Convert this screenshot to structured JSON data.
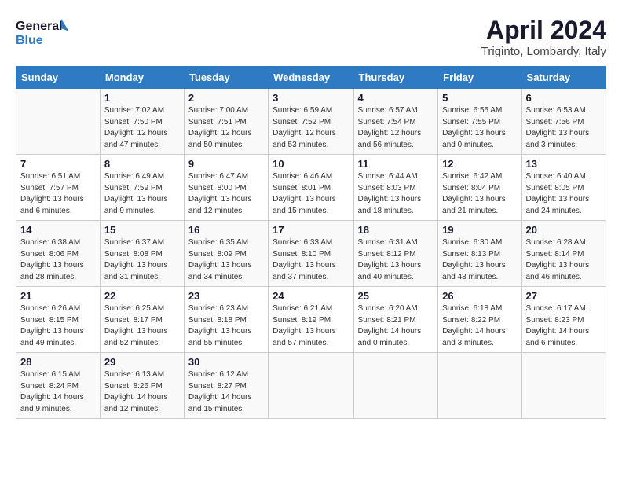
{
  "header": {
    "logo_line1": "General",
    "logo_line2": "Blue",
    "month_year": "April 2024",
    "location": "Triginto, Lombardy, Italy"
  },
  "days_of_week": [
    "Sunday",
    "Monday",
    "Tuesday",
    "Wednesday",
    "Thursday",
    "Friday",
    "Saturday"
  ],
  "weeks": [
    [
      {
        "day": "",
        "sunrise": "",
        "sunset": "",
        "daylight": ""
      },
      {
        "day": "1",
        "sunrise": "Sunrise: 7:02 AM",
        "sunset": "Sunset: 7:50 PM",
        "daylight": "Daylight: 12 hours and 47 minutes."
      },
      {
        "day": "2",
        "sunrise": "Sunrise: 7:00 AM",
        "sunset": "Sunset: 7:51 PM",
        "daylight": "Daylight: 12 hours and 50 minutes."
      },
      {
        "day": "3",
        "sunrise": "Sunrise: 6:59 AM",
        "sunset": "Sunset: 7:52 PM",
        "daylight": "Daylight: 12 hours and 53 minutes."
      },
      {
        "day": "4",
        "sunrise": "Sunrise: 6:57 AM",
        "sunset": "Sunset: 7:54 PM",
        "daylight": "Daylight: 12 hours and 56 minutes."
      },
      {
        "day": "5",
        "sunrise": "Sunrise: 6:55 AM",
        "sunset": "Sunset: 7:55 PM",
        "daylight": "Daylight: 13 hours and 0 minutes."
      },
      {
        "day": "6",
        "sunrise": "Sunrise: 6:53 AM",
        "sunset": "Sunset: 7:56 PM",
        "daylight": "Daylight: 13 hours and 3 minutes."
      }
    ],
    [
      {
        "day": "7",
        "sunrise": "Sunrise: 6:51 AM",
        "sunset": "Sunset: 7:57 PM",
        "daylight": "Daylight: 13 hours and 6 minutes."
      },
      {
        "day": "8",
        "sunrise": "Sunrise: 6:49 AM",
        "sunset": "Sunset: 7:59 PM",
        "daylight": "Daylight: 13 hours and 9 minutes."
      },
      {
        "day": "9",
        "sunrise": "Sunrise: 6:47 AM",
        "sunset": "Sunset: 8:00 PM",
        "daylight": "Daylight: 13 hours and 12 minutes."
      },
      {
        "day": "10",
        "sunrise": "Sunrise: 6:46 AM",
        "sunset": "Sunset: 8:01 PM",
        "daylight": "Daylight: 13 hours and 15 minutes."
      },
      {
        "day": "11",
        "sunrise": "Sunrise: 6:44 AM",
        "sunset": "Sunset: 8:03 PM",
        "daylight": "Daylight: 13 hours and 18 minutes."
      },
      {
        "day": "12",
        "sunrise": "Sunrise: 6:42 AM",
        "sunset": "Sunset: 8:04 PM",
        "daylight": "Daylight: 13 hours and 21 minutes."
      },
      {
        "day": "13",
        "sunrise": "Sunrise: 6:40 AM",
        "sunset": "Sunset: 8:05 PM",
        "daylight": "Daylight: 13 hours and 24 minutes."
      }
    ],
    [
      {
        "day": "14",
        "sunrise": "Sunrise: 6:38 AM",
        "sunset": "Sunset: 8:06 PM",
        "daylight": "Daylight: 13 hours and 28 minutes."
      },
      {
        "day": "15",
        "sunrise": "Sunrise: 6:37 AM",
        "sunset": "Sunset: 8:08 PM",
        "daylight": "Daylight: 13 hours and 31 minutes."
      },
      {
        "day": "16",
        "sunrise": "Sunrise: 6:35 AM",
        "sunset": "Sunset: 8:09 PM",
        "daylight": "Daylight: 13 hours and 34 minutes."
      },
      {
        "day": "17",
        "sunrise": "Sunrise: 6:33 AM",
        "sunset": "Sunset: 8:10 PM",
        "daylight": "Daylight: 13 hours and 37 minutes."
      },
      {
        "day": "18",
        "sunrise": "Sunrise: 6:31 AM",
        "sunset": "Sunset: 8:12 PM",
        "daylight": "Daylight: 13 hours and 40 minutes."
      },
      {
        "day": "19",
        "sunrise": "Sunrise: 6:30 AM",
        "sunset": "Sunset: 8:13 PM",
        "daylight": "Daylight: 13 hours and 43 minutes."
      },
      {
        "day": "20",
        "sunrise": "Sunrise: 6:28 AM",
        "sunset": "Sunset: 8:14 PM",
        "daylight": "Daylight: 13 hours and 46 minutes."
      }
    ],
    [
      {
        "day": "21",
        "sunrise": "Sunrise: 6:26 AM",
        "sunset": "Sunset: 8:15 PM",
        "daylight": "Daylight: 13 hours and 49 minutes."
      },
      {
        "day": "22",
        "sunrise": "Sunrise: 6:25 AM",
        "sunset": "Sunset: 8:17 PM",
        "daylight": "Daylight: 13 hours and 52 minutes."
      },
      {
        "day": "23",
        "sunrise": "Sunrise: 6:23 AM",
        "sunset": "Sunset: 8:18 PM",
        "daylight": "Daylight: 13 hours and 55 minutes."
      },
      {
        "day": "24",
        "sunrise": "Sunrise: 6:21 AM",
        "sunset": "Sunset: 8:19 PM",
        "daylight": "Daylight: 13 hours and 57 minutes."
      },
      {
        "day": "25",
        "sunrise": "Sunrise: 6:20 AM",
        "sunset": "Sunset: 8:21 PM",
        "daylight": "Daylight: 14 hours and 0 minutes."
      },
      {
        "day": "26",
        "sunrise": "Sunrise: 6:18 AM",
        "sunset": "Sunset: 8:22 PM",
        "daylight": "Daylight: 14 hours and 3 minutes."
      },
      {
        "day": "27",
        "sunrise": "Sunrise: 6:17 AM",
        "sunset": "Sunset: 8:23 PM",
        "daylight": "Daylight: 14 hours and 6 minutes."
      }
    ],
    [
      {
        "day": "28",
        "sunrise": "Sunrise: 6:15 AM",
        "sunset": "Sunset: 8:24 PM",
        "daylight": "Daylight: 14 hours and 9 minutes."
      },
      {
        "day": "29",
        "sunrise": "Sunrise: 6:13 AM",
        "sunset": "Sunset: 8:26 PM",
        "daylight": "Daylight: 14 hours and 12 minutes."
      },
      {
        "day": "30",
        "sunrise": "Sunrise: 6:12 AM",
        "sunset": "Sunset: 8:27 PM",
        "daylight": "Daylight: 14 hours and 15 minutes."
      },
      {
        "day": "",
        "sunrise": "",
        "sunset": "",
        "daylight": ""
      },
      {
        "day": "",
        "sunrise": "",
        "sunset": "",
        "daylight": ""
      },
      {
        "day": "",
        "sunrise": "",
        "sunset": "",
        "daylight": ""
      },
      {
        "day": "",
        "sunrise": "",
        "sunset": "",
        "daylight": ""
      }
    ]
  ]
}
